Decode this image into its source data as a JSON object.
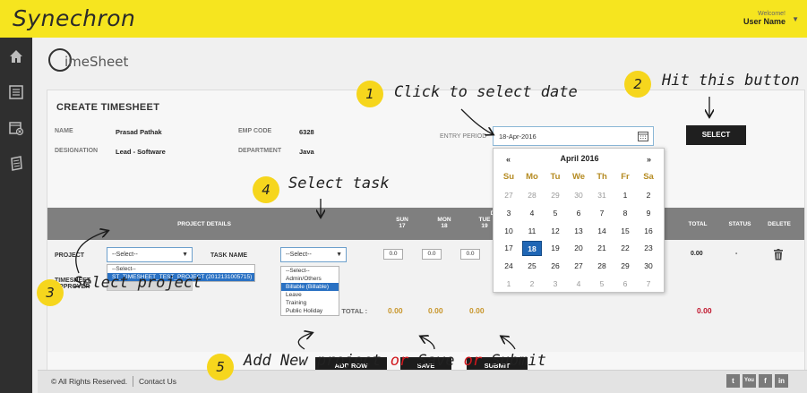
{
  "app": {
    "logo_text": "Synechron",
    "welcome": "Welcome!",
    "user_name": "User Name"
  },
  "brand": {
    "text": "imeSheet"
  },
  "form": {
    "title": "CREATE TIMESHEET",
    "name_label": "NAME",
    "name_value": "Prasad Pathak",
    "emp_label": "EMP CODE",
    "emp_value": "6328",
    "designation_label": "DESIGNATION",
    "designation_value": "Lead - Software",
    "department_label": "DEPARTMENT",
    "department_value": "Java",
    "entry_label": "ENTRY PERIOD",
    "entry_value": "18-Apr-2016",
    "select_button": "SELECT"
  },
  "grid": {
    "project_details": "PROJECT DETAILS",
    "days": [
      {
        "name": "SUN",
        "num": "17"
      },
      {
        "name": "MON",
        "num": "18"
      },
      {
        "name": "TUE",
        "num": "19"
      }
    ],
    "col_d": "D",
    "total": "TOTAL",
    "status": "STATUS",
    "delete": "DELETE",
    "project_label": "PROJECT",
    "task_label": "TASK NAME",
    "approver_label_1": "TIMESHEET",
    "approver_label_2": "APPROVER",
    "project_select": "--Select--",
    "task_select": "--Select--",
    "project_options": [
      "--Select--",
      "ST_TIMESHEET_TEST_PROJECT (2012131005715)"
    ],
    "task_options": [
      "--Select--",
      "Admin/Others",
      "Billable (Billable)",
      "Leave",
      "Training",
      "Public Holiday"
    ],
    "cells": [
      "0.0",
      "0.0",
      "0.0"
    ],
    "row_total": "0.00",
    "row_status": "-",
    "daywise_label": "DAYWISE TOTAL :",
    "daywise_values": [
      "0.00",
      "0.00",
      "0.00"
    ],
    "grand_total": "0.00"
  },
  "buttons": {
    "add_row": "ADD ROW",
    "save": "SAVE",
    "submit": "SUBMIT"
  },
  "calendar": {
    "prev": "«",
    "next": "»",
    "title": "April 2016",
    "weekdays": [
      "Su",
      "Mo",
      "Tu",
      "We",
      "Th",
      "Fr",
      "Sa"
    ],
    "weeks": [
      [
        "27",
        "28",
        "29",
        "30",
        "31",
        "1",
        "2"
      ],
      [
        "3",
        "4",
        "5",
        "6",
        "7",
        "8",
        "9"
      ],
      [
        "10",
        "11",
        "12",
        "13",
        "14",
        "15",
        "16"
      ],
      [
        "17",
        "18",
        "19",
        "20",
        "21",
        "22",
        "23"
      ],
      [
        "24",
        "25",
        "26",
        "27",
        "28",
        "29",
        "30"
      ],
      [
        "1",
        "2",
        "3",
        "4",
        "5",
        "6",
        "7"
      ]
    ],
    "selected": "18"
  },
  "footer": {
    "copyright": "© All Rights Reserved.",
    "contact": "Contact Us",
    "social": [
      "t",
      "You",
      "f",
      "in"
    ]
  },
  "annotations": {
    "n1": "1",
    "t1": "Click to select date",
    "n2": "2",
    "t2": "Hit this button",
    "n3": "3",
    "t3": "Select project",
    "n4": "4",
    "t4": "Select task",
    "n5": "5",
    "t5a": "Add New project ",
    "t5b": "or",
    "t5c": " Save ",
    "t5d": "or",
    "t5e": " Submit"
  },
  "icons": [
    "home-icon",
    "list-icon",
    "calendar-x-icon",
    "document-icon",
    "calendar-icon",
    "chevron-down-icon",
    "trash-icon"
  ],
  "colors": {
    "topbar": "#f6e51f",
    "sidebar": "#2f2f2f",
    "accent": "#1f66b5",
    "weekday": "#b58b22",
    "total_red": "#c0142b"
  }
}
